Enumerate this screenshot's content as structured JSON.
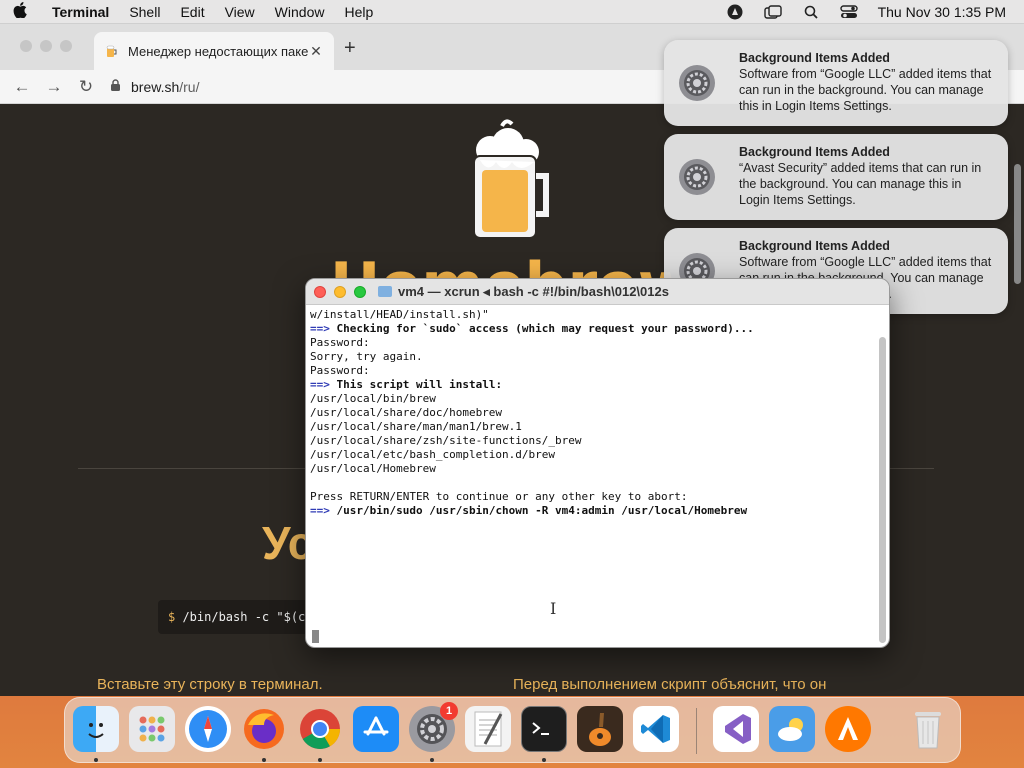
{
  "menubar": {
    "app_name": "Terminal",
    "menus": [
      "Shell",
      "Edit",
      "View",
      "Window",
      "Help"
    ],
    "clock": "Thu Nov 30  1:35 PM"
  },
  "browser": {
    "tab_title": "Менеджер недостающих паке",
    "url_host": "brew.sh",
    "url_path": "/ru/",
    "page": {
      "brand": "Homebrew",
      "heading": "Ус",
      "code_prompt": "$",
      "code_text": " /bin/bash -c \"$(cur",
      "caption_left": "Вставьте эту строку в терминал.",
      "caption_right": "Перед выполнением скрипт объяснит, что он"
    }
  },
  "notifications": [
    {
      "title": "Background Items Added",
      "body": "Software from “Google LLC” added items that can run in the background. You can manage this in Login Items Settings."
    },
    {
      "title": "Background Items Added",
      "body": "“Avast Security” added items that can run in the background. You can manage this in Login Items Settings."
    },
    {
      "title": "Background Items Added",
      "body": "Software from “Google LLC” added items that can run in the background. You can manage this in Login Items Settings."
    }
  ],
  "terminal": {
    "title": "vm4 — xcrun ◂ bash -c #!/bin/bash\\012\\012s",
    "lines": [
      {
        "prefix": "",
        "text": "w/install/HEAD/install.sh)\"",
        "bold": false
      },
      {
        "prefix": "==>",
        "text": " Checking for `sudo` access (which may request your password)...",
        "bold": true
      },
      {
        "prefix": "",
        "text": "Password:",
        "bold": false
      },
      {
        "prefix": "",
        "text": "Sorry, try again.",
        "bold": false
      },
      {
        "prefix": "",
        "text": "Password:",
        "bold": false
      },
      {
        "prefix": "==>",
        "text": " This script will install:",
        "bold": true
      },
      {
        "prefix": "",
        "text": "/usr/local/bin/brew",
        "bold": false
      },
      {
        "prefix": "",
        "text": "/usr/local/share/doc/homebrew",
        "bold": false
      },
      {
        "prefix": "",
        "text": "/usr/local/share/man/man1/brew.1",
        "bold": false
      },
      {
        "prefix": "",
        "text": "/usr/local/share/zsh/site-functions/_brew",
        "bold": false
      },
      {
        "prefix": "",
        "text": "/usr/local/etc/bash_completion.d/brew",
        "bold": false
      },
      {
        "prefix": "",
        "text": "/usr/local/Homebrew",
        "bold": false
      },
      {
        "prefix": "",
        "text": "",
        "bold": false
      },
      {
        "prefix": "",
        "text": "Press RETURN/ENTER to continue or any other key to abort:",
        "bold": false
      },
      {
        "prefix": "==>",
        "text": " /usr/bin/sudo /usr/sbin/chown -R vm4:admin /usr/local/Homebrew",
        "bold": true
      }
    ]
  },
  "dock": {
    "apps": [
      "finder-icon",
      "launchpad-icon",
      "safari-icon",
      "firefox-icon",
      "chrome-icon",
      "app-store-icon",
      "system-settings-icon",
      "textedit-icon",
      "terminal-icon",
      "garageband-icon",
      "vscode-icon",
      "visual-studio-icon",
      "weather-icon",
      "avast-icon",
      "trash-icon"
    ],
    "settings_badge": "1"
  }
}
